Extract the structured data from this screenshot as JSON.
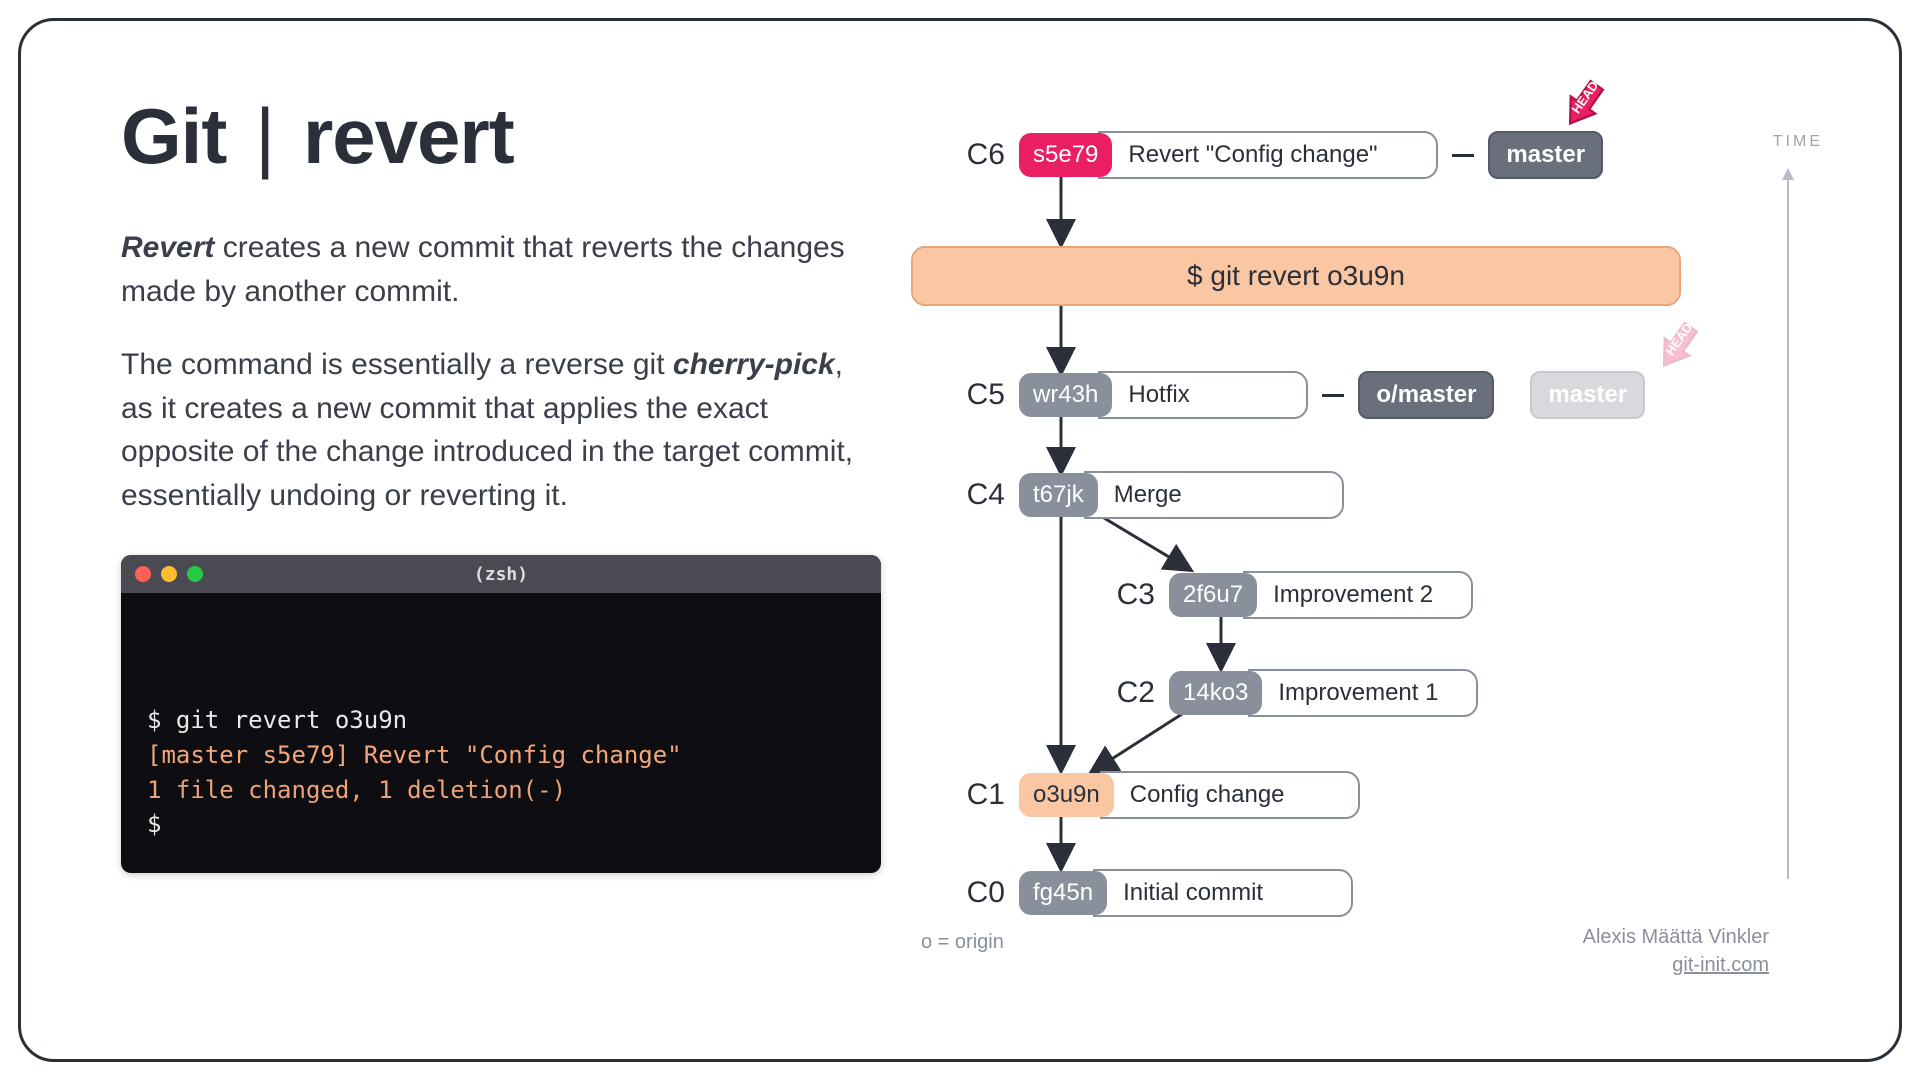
{
  "title": {
    "prefix": "Git",
    "sep": "|",
    "cmd": "revert"
  },
  "para1_bold": "Revert",
  "para1_rest": " creates a new commit that reverts the changes made by another commit.",
  "para2_a": "The command is essentially a reverse git ",
  "para2_bold": "cherry-pick",
  "para2_b": ", as it creates a new commit that applies the exact opposite of the change introduced in the target commit, essentially undoing or reverting it.",
  "terminal": {
    "title": "(zsh)",
    "line1": "$ git revert o3u9n",
    "line2": "[master s5e79] Revert \"Config change\"",
    "line3": "1 file changed, 1 deletion(-)",
    "line4": "$"
  },
  "cmd_bar": "$ git revert o3u9n",
  "commits": {
    "c6": {
      "label": "C6",
      "hash": "s5e79",
      "msg": "Revert \"Config change\""
    },
    "c5": {
      "label": "C5",
      "hash": "wr43h",
      "msg": "Hotfix"
    },
    "c4": {
      "label": "C4",
      "hash": "t67jk",
      "msg": "Merge"
    },
    "c3": {
      "label": "C3",
      "hash": "2f6u7",
      "msg": "Improvement 2"
    },
    "c2": {
      "label": "C2",
      "hash": "14ko3",
      "msg": "Improvement 1"
    },
    "c1": {
      "label": "C1",
      "hash": "o3u9n",
      "msg": "Config change"
    },
    "c0": {
      "label": "C0",
      "hash": "fg45n",
      "msg": "Initial commit"
    }
  },
  "branches": {
    "master": "master",
    "omaster": "o/master",
    "ghost_master": "master"
  },
  "head": "HEAD",
  "time": "TIME",
  "legend": "o = origin",
  "author": "Alexis Määttä Vinkler",
  "site": "git-init.com"
}
